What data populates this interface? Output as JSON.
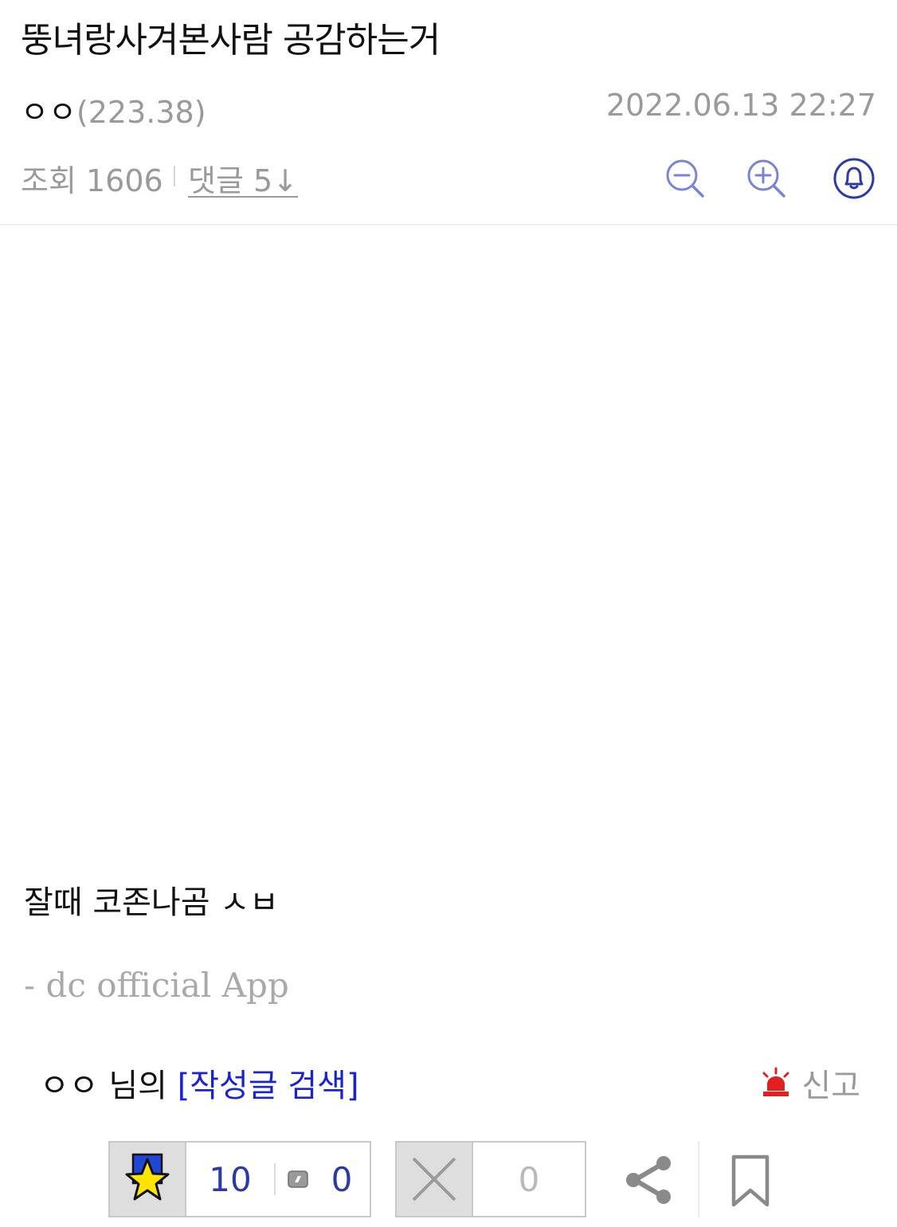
{
  "post": {
    "title": "뚱녀랑사겨본사람 공감하는거",
    "author_nick": "ㅇㅇ",
    "author_ip": "(223.38)",
    "date": "2022.06.13 22:27",
    "views_label": "조회 1606",
    "comments_label": "댓글 5↓",
    "body": "잘때 코존나곰 ㅅㅂ",
    "app_sign": "- dc official App"
  },
  "writer": {
    "nick": "ㅇㅇ",
    "suffix": " 님의 ",
    "search_link": "[작성글 검색]"
  },
  "report": {
    "label": "신고"
  },
  "votes": {
    "recommend_count": "10",
    "fix_count": "0",
    "down_count": "0"
  },
  "colors": {
    "accent_blue": "#2b3aa6",
    "link_blue": "#1a23d4",
    "icon_purple": "#7b83d6",
    "report_red": "#e0211f",
    "star_yellow": "#ffe400"
  },
  "icons": [
    "zoom-out-icon",
    "zoom-in-icon",
    "bell-icon",
    "siren-icon",
    "star-icon",
    "fix-icon",
    "x-icon",
    "share-icon",
    "bookmark-icon"
  ]
}
